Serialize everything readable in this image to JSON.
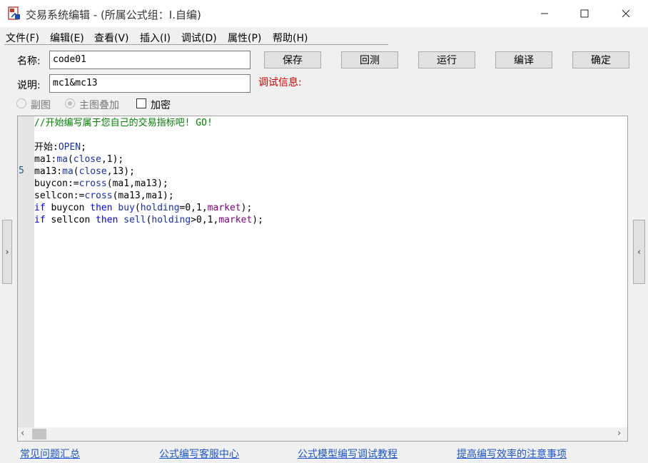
{
  "window": {
    "title": "交易系统编辑 - (所属公式组：I.自编)",
    "minimize_icon": "minimize-icon",
    "maximize_icon": "maximize-icon",
    "close_icon": "close-icon"
  },
  "menu": {
    "items": [
      "文件(F)",
      "编辑(E)",
      "查看(V)",
      "插入(I)",
      "调试(D)",
      "属性(P)",
      "帮助(H)"
    ]
  },
  "form": {
    "name_label": "名称:",
    "name_value": "code01",
    "desc_label": "说明:",
    "desc_value": "mc1&mc13",
    "debug_label": "调试信息:"
  },
  "buttons": {
    "save": "保存",
    "backtest": "回测",
    "run": "运行",
    "compile": "编译",
    "confirm": "确定"
  },
  "options": {
    "sub_chart": "副图",
    "main_overlay": "主图叠加",
    "encrypt": "加密",
    "main_overlay_checked": true,
    "encrypt_checked": false
  },
  "editor": {
    "line_number": "5",
    "lines": [
      [
        [
          "c-comment",
          "//开始编写属于您自己的交易指标吧! GO!"
        ]
      ],
      [],
      [
        [
          "c-id",
          "开始:"
        ],
        [
          "c-fn",
          "OPEN"
        ],
        [
          "c-id",
          ";"
        ]
      ],
      [
        [
          "c-id",
          "ma1:"
        ],
        [
          "c-fn",
          "ma"
        ],
        [
          "c-id",
          "("
        ],
        [
          "c-fn",
          "close"
        ],
        [
          "c-id",
          ",1);"
        ]
      ],
      [
        [
          "c-id",
          "ma13:"
        ],
        [
          "c-fn",
          "ma"
        ],
        [
          "c-id",
          "("
        ],
        [
          "c-fn",
          "close"
        ],
        [
          "c-id",
          ",13);"
        ]
      ],
      [
        [
          "c-id",
          "buycon:="
        ],
        [
          "c-fn",
          "cross"
        ],
        [
          "c-id",
          "(ma1,ma13);"
        ]
      ],
      [
        [
          "c-id",
          "sellcon:="
        ],
        [
          "c-fn",
          "cross"
        ],
        [
          "c-id",
          "(ma13,ma1);"
        ]
      ],
      [
        [
          "c-kw",
          "if"
        ],
        [
          "c-id",
          " buycon "
        ],
        [
          "c-kw",
          "then"
        ],
        [
          "c-id",
          " "
        ],
        [
          "c-fn",
          "buy"
        ],
        [
          "c-id",
          "("
        ],
        [
          "c-fn",
          "holding"
        ],
        [
          "c-id",
          "=0,1,"
        ],
        [
          "c-mk",
          "market"
        ],
        [
          "c-id",
          ");"
        ]
      ],
      [
        [
          "c-kw",
          "if"
        ],
        [
          "c-id",
          " sellcon "
        ],
        [
          "c-kw",
          "then"
        ],
        [
          "c-id",
          " "
        ],
        [
          "c-fn",
          "sell"
        ],
        [
          "c-id",
          "("
        ],
        [
          "c-fn",
          "holding"
        ],
        [
          "c-id",
          ">0,1,"
        ],
        [
          "c-mk",
          "market"
        ],
        [
          "c-id",
          ");"
        ]
      ]
    ]
  },
  "side_tabs": {
    "left_icon": "chevron-right-icon",
    "right_icon": "chevron-left-icon"
  },
  "links": {
    "faq": "常见问题汇总",
    "service": "公式编写客服中心",
    "tutorial": "公式模型编写调试教程",
    "tips": "提高编写效率的注意事项"
  }
}
